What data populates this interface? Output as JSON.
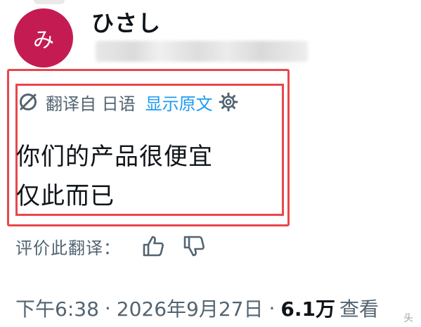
{
  "author": {
    "avatar_text": "み",
    "avatar_color": "#c41c52",
    "display_name": "ひさし"
  },
  "translation": {
    "icon": "translate-icon",
    "prefix": "翻译自 日语",
    "show_original": "显示原文",
    "settings_icon": "gear-icon",
    "highlight_color": "#e8474c"
  },
  "tweet": {
    "line1": "你们的产品很便宜",
    "line2": "仅此而已"
  },
  "rating": {
    "label": "评价此翻译：",
    "up_icon": "thumbs-up-icon",
    "down_icon": "thumbs-down-icon"
  },
  "meta": {
    "time": "下午6:38",
    "separator": "·",
    "date": "2026年9月27日",
    "views_count": "6.1万",
    "views_label": "查看"
  },
  "watermark": {
    "text": "头条"
  },
  "colors": {
    "link": "#1d9bf0",
    "secondary_text": "#536471",
    "primary_text": "#0f1419"
  }
}
